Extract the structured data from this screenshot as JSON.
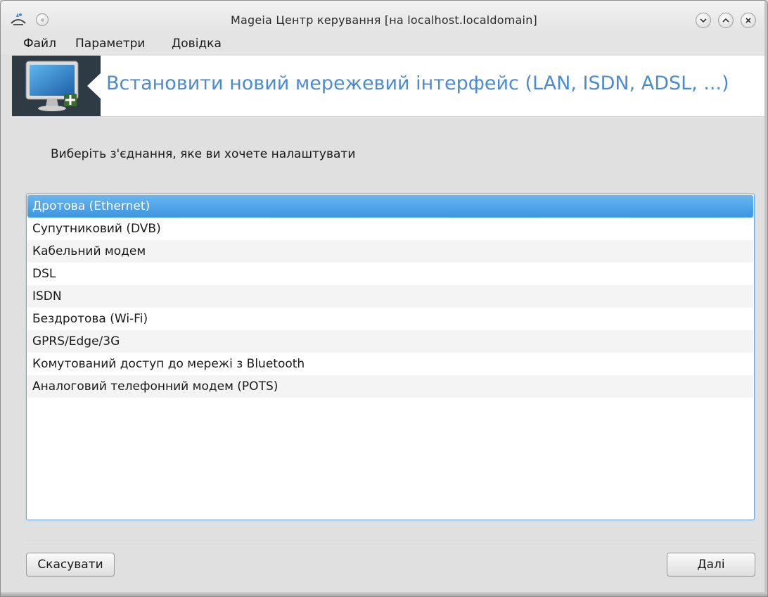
{
  "window": {
    "title": "Mageia Центр керування  [на localhost.localdomain]"
  },
  "menubar": {
    "items": [
      {
        "label": "Файл"
      },
      {
        "label": "Параметри"
      },
      {
        "label": "Довідка"
      }
    ]
  },
  "banner": {
    "title": "Встановити новий мережевий інтерфейс (LAN, ISDN, ADSL, ...)",
    "icon": "network-monitor-icon"
  },
  "prompt": "Виберіть з'єднання, яке ви хочете налаштувати",
  "connections": {
    "selected_index": 0,
    "items": [
      {
        "label": "Дротова (Ethernet)"
      },
      {
        "label": "Супутниковий (DVB)"
      },
      {
        "label": "Кабельний модем"
      },
      {
        "label": "DSL"
      },
      {
        "label": "ISDN"
      },
      {
        "label": "Бездротова (Wi-Fi)"
      },
      {
        "label": "GPRS/Edge/3G"
      },
      {
        "label": "Комутований доступ до мережі з Bluetooth"
      },
      {
        "label": "Аналоговий телефонний модем (POTS)"
      }
    ]
  },
  "buttons": {
    "cancel": "Скасувати",
    "next": "Далі"
  },
  "colors": {
    "accent": "#4a8bd6",
    "selection": "#3b96e0"
  }
}
